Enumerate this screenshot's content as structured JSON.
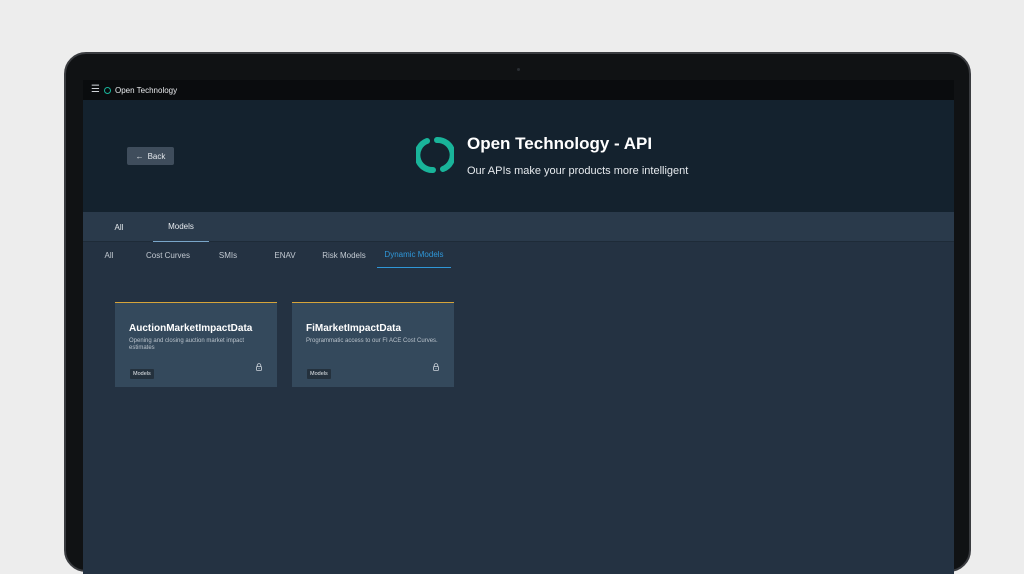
{
  "app": {
    "brand_name": "Open Technology",
    "brand_color": "#19b49a"
  },
  "topbar": {
    "menu_icon": "hamburger-icon",
    "logo_icon": "open-technology-logo"
  },
  "hero": {
    "back_label": "Back",
    "back_icon": "arrow-left-icon",
    "title": "Open Technology - API",
    "subtitle": "Our APIs make your products more intelligent"
  },
  "primary_tabs": [
    {
      "label": "All",
      "active": false
    },
    {
      "label": "Models",
      "active": true
    }
  ],
  "secondary_tabs": [
    {
      "label": "All",
      "active": false
    },
    {
      "label": "Cost Curves",
      "active": false
    },
    {
      "label": "SMIs",
      "active": false
    },
    {
      "label": "ENAV",
      "active": false
    },
    {
      "label": "Risk Models",
      "active": false
    },
    {
      "label": "Dynamic Models",
      "active": true
    }
  ],
  "accent_color": "#2f97d8",
  "card_accent_color": "#d6a43a",
  "cards": [
    {
      "title": "AuctionMarketImpactData",
      "description": "Opening and closing auction market impact estimates",
      "tag": "Models",
      "icon": "lock-icon"
    },
    {
      "title": "FiMarketImpactData",
      "description": "Programmatic access to our FI ACE Cost Curves.",
      "tag": "Models",
      "icon": "lock-icon"
    }
  ]
}
